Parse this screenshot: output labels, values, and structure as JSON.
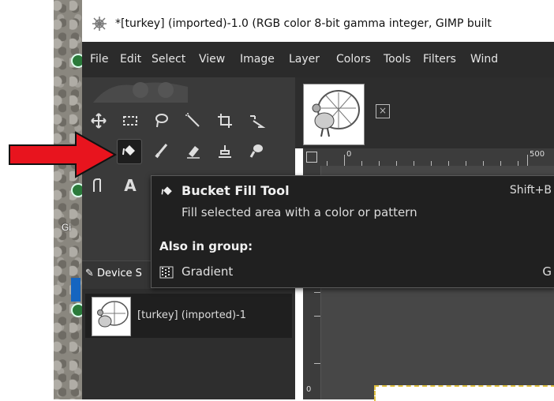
{
  "window": {
    "title": "*[turkey] (imported)-1.0 (RGB color 8-bit gamma integer, GIMP built"
  },
  "menubar": {
    "items": [
      "File",
      "Edit",
      "Select",
      "View",
      "Image",
      "Layer",
      "Colors",
      "Tools",
      "Filters",
      "Wind"
    ]
  },
  "desktop": {
    "label": "Gi"
  },
  "ruler": {
    "labels": [
      "0",
      "500"
    ]
  },
  "vruler": {
    "label": "0"
  },
  "tooltip": {
    "title": "Bucket Fill Tool",
    "shortcut": "Shift+B",
    "description": "Fill selected area with a color or pattern",
    "group_heading": "Also in group:",
    "group_item": "Gradient",
    "group_item_shortcut": "G"
  },
  "device_status": {
    "tab_label": "Device S"
  },
  "image_list": {
    "items": [
      {
        "label": "[turkey] (imported)-1"
      }
    ]
  },
  "colors": {
    "arrow": "#e8141e",
    "menubar_bg": "#2b2b2b",
    "toolbox_bg": "#3a3a3a",
    "tooltip_bg": "#202020"
  }
}
